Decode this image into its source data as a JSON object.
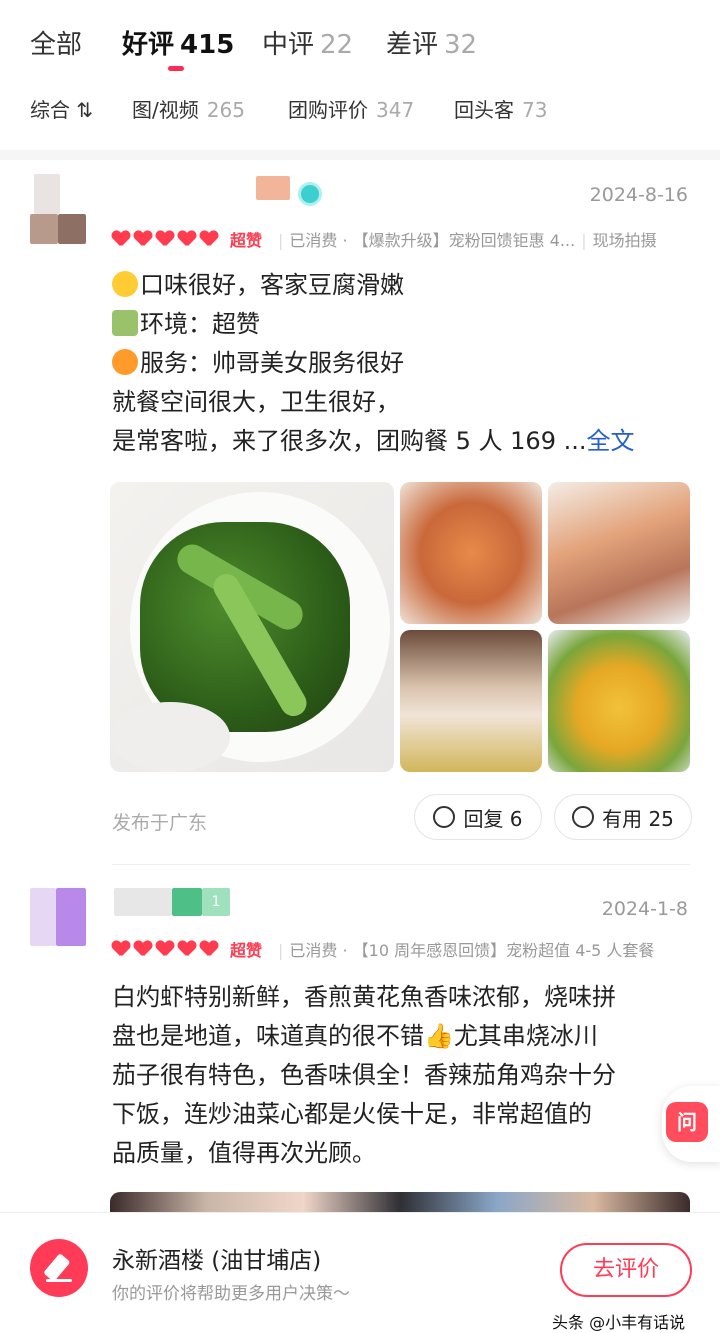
{
  "tabs": [
    {
      "label": "全部",
      "count": ""
    },
    {
      "label": "好评",
      "count": "415"
    },
    {
      "label": "中评",
      "count": "22"
    },
    {
      "label": "差评",
      "count": "32"
    }
  ],
  "filters": [
    {
      "label": "综合 ⇅",
      "count": ""
    },
    {
      "label": "图/视频",
      "count": "265"
    },
    {
      "label": "团购评价",
      "count": "347"
    },
    {
      "label": "回头客",
      "count": "73"
    }
  ],
  "reviews": [
    {
      "date": "2024-8-16",
      "rating_word": "超赞",
      "meta": "已消费 · 【爆款升级】宠粉回馈钜惠 4...",
      "meta_tag": "现场拍摄",
      "lines": [
        "口味很好，客家豆腐滑嫩",
        "环境：超赞",
        "服务：帅哥美女服务很好",
        "就餐空间很大，卫生很好，",
        "是常客啦，来了很多次，团购餐 5 人 169 ..."
      ],
      "fulltext": "全文",
      "published": "发布于广东",
      "reply_label": "回复 6",
      "useful_label": "有用 25"
    },
    {
      "date": "2024-1-8",
      "rating_word": "超赞",
      "meta": "已消费 · 【10 周年感恩回馈】宠粉超值 4-5 人套餐",
      "lines": [
        "白灼虾特别新鲜，香煎黄花魚香味浓郁，烧味拼",
        "盘也是地道，味道真的很不错👍尤其串烧冰川",
        "茄子很有特色，色香味俱全！香辣茄角鸡杂十分",
        "下饭，连炒油菜心都是火侯十足，非常超值的",
        "品质量，值得再次光顾。"
      ],
      "user_badge": "1"
    }
  ],
  "ask_button": "问",
  "bottom": {
    "shop_name": "永新酒楼 (油甘埔店)",
    "shop_sub": "你的评价将帮助更多用户决策～",
    "review_button": "去评价",
    "watermark": "头条 @小丰有话说"
  },
  "colors": {
    "accent": "#ff3b57",
    "link": "#2460c7",
    "heart": "#ff3b4f"
  }
}
